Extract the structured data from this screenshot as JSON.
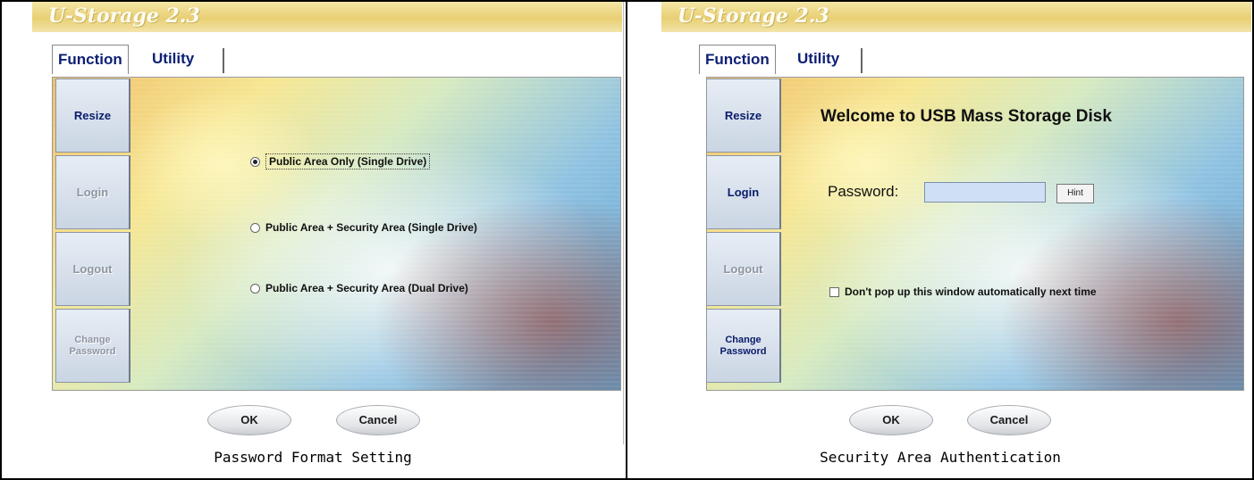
{
  "panels": [
    {
      "app_title": "U-Storage 2.3",
      "tabs": [
        "Function",
        "Utility"
      ],
      "sidebar": [
        {
          "label": "Resize"
        },
        {
          "label": "Login"
        },
        {
          "label": "Logout"
        },
        {
          "label": "Change Password"
        }
      ],
      "options": [
        {
          "label": "Public Area Only (Single Drive)",
          "selected": true
        },
        {
          "label": "Public Area + Security Area (Single Drive)",
          "selected": false
        },
        {
          "label": "Public Area + Security Area (Dual Drive)",
          "selected": false
        }
      ],
      "buttons": {
        "ok": "OK",
        "cancel": "Cancel"
      },
      "caption": "Password Format Setting"
    },
    {
      "app_title": "U-Storage 2.3",
      "tabs": [
        "Function",
        "Utility"
      ],
      "sidebar": [
        {
          "label": "Resize"
        },
        {
          "label": "Login"
        },
        {
          "label": "Logout"
        },
        {
          "label": "Change Password"
        }
      ],
      "welcome": "Welcome to USB Mass Storage Disk",
      "password_label": "Password:",
      "password_value": "",
      "hint_button": "Hint",
      "checkbox_label": "Don't pop up this window automatically next time",
      "buttons": {
        "ok": "OK",
        "cancel": "Cancel"
      },
      "caption": "Security Area Authentication"
    }
  ]
}
